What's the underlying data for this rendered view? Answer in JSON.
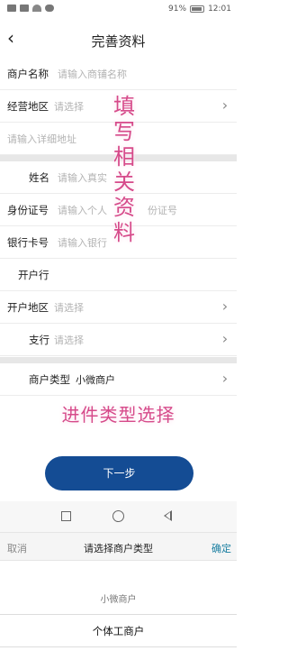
{
  "status_bar": {
    "battery_percent": "91%",
    "time": "12:01"
  },
  "header": {
    "title": "完善资料"
  },
  "form": {
    "merchant_name": {
      "label": "商户名称",
      "placeholder": "请输入商铺名称"
    },
    "business_area": {
      "label": "经营地区",
      "placeholder": "请选择"
    },
    "detail_address": {
      "placeholder": "请输入详细地址"
    },
    "name": {
      "label": "姓名",
      "placeholder": "请输入真实"
    },
    "id_number": {
      "label": "身份证号",
      "placeholder": "请输入个人",
      "placeholder_tail": "份证号"
    },
    "bank_card": {
      "label": "银行卡号",
      "placeholder": "请输入银行"
    },
    "bank": {
      "label": "开户行"
    },
    "bank_area": {
      "label": "开户地区",
      "placeholder": "请选择"
    },
    "branch": {
      "label": "支行",
      "placeholder": "请选择"
    },
    "merchant_type": {
      "label": "商户类型",
      "value": "小微商户"
    }
  },
  "annotations": {
    "vertical": [
      "填",
      "写",
      "相",
      "关",
      "资",
      "料"
    ],
    "horizontal": "进件类型选择"
  },
  "next_button": {
    "label": "下一步"
  },
  "picker": {
    "cancel": "取消",
    "title": "请选择商户类型",
    "confirm": "确定",
    "options": [
      "小微商户",
      "个体工商户"
    ]
  },
  "colors": {
    "primary": "#144c94",
    "confirm": "#1a7fa1",
    "annotation": "#d64a8a"
  }
}
